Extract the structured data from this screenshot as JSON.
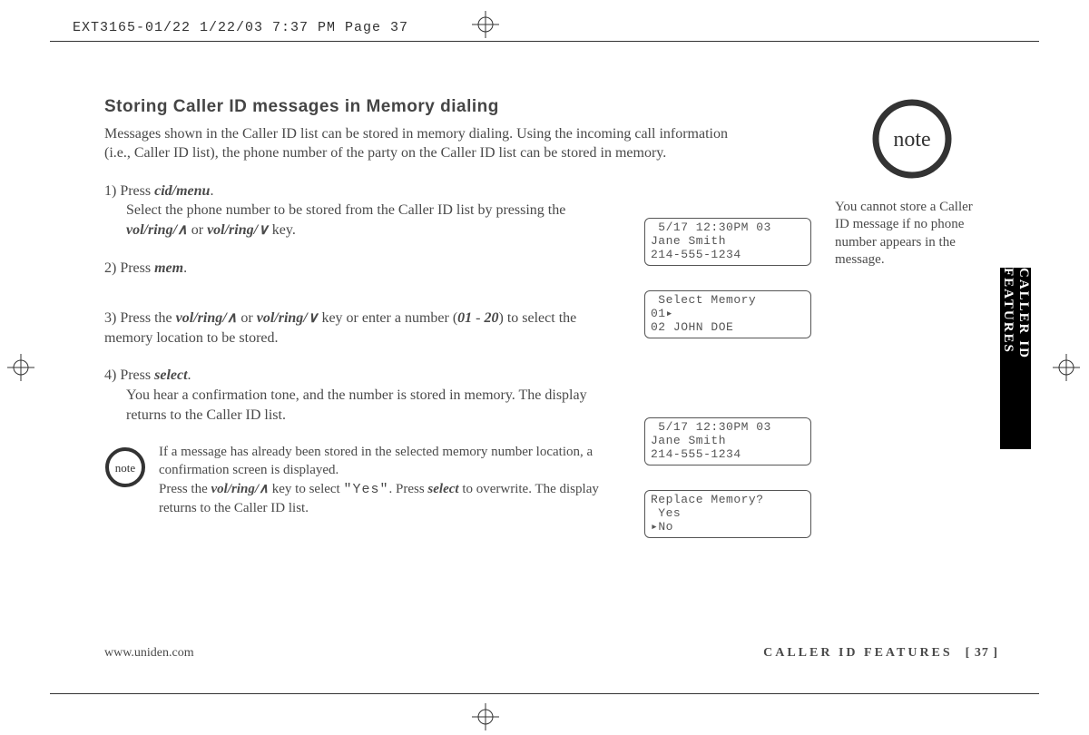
{
  "header_line": "EXT3165-01/22  1/22/03  7:37 PM  Page 37",
  "title": "Storing Caller ID messages in Memory dialing",
  "intro": "Messages shown in the Caller ID list can be stored in memory dialing. Using the incoming call information (i.e., Caller ID list), the phone number of the party on the Caller ID list can be stored in memory.",
  "steps": {
    "s1_num": "1) Press ",
    "s1_cmd": "cid/menu",
    "s1_dot": ".",
    "s1_body_a": "Select the phone number to be stored from the Caller ID list by pressing the ",
    "s1_key1": "vol/ring/",
    "s1_or": " or ",
    "s1_key2": "vol/ring/",
    "s1_end": " key.",
    "s2_num": "2) Press ",
    "s2_cmd": "mem",
    "s2_dot": ".",
    "s3_num": "3) Press the ",
    "s3_key1": "vol/ring/",
    "s3_or": " or ",
    "s3_key2": "vol/ring/",
    "s3_mid": " key or enter a number (",
    "s3_b01": "01",
    "s3_dash": " - ",
    "s3_b20": "20",
    "s3_end": ") to select the memory location to be stored.",
    "s4_num": "4) Press ",
    "s4_cmd": "select",
    "s4_dot": ".",
    "s4_body": "You hear a confirmation tone, and the number is stored in memory. The display returns to the Caller ID list."
  },
  "inline_note": {
    "a": "If a message has already been stored in the selected memory number location, a confirmation screen is displayed.",
    "b_pre": "Press the ",
    "b_key": "vol/ring/",
    "b_mid": " key to select ",
    "b_yes": "\"Yes\"",
    "b_press": ". Press ",
    "b_sel": "select",
    "b_end": " to overwrite. The display returns to the Caller ID list."
  },
  "lcds": {
    "l1": " 5/17 12:30PM 03\nJane Smith\n214-555-1234",
    "l2": " Select Memory\n01▸\n02 JOHN DOE",
    "l3": " 5/17 12:30PM 03\nJane Smith\n214-555-1234",
    "l4": "Replace Memory?\n Yes\n▸No"
  },
  "sidebar_note": "You cannot store a Caller ID message if no phone number appears in the message.",
  "side_tab": "CALLER ID FEATURES",
  "note_icon_label": "note",
  "footer": {
    "url": "www.uniden.com",
    "section": "CALLER ID FEATURES",
    "page": "[ 37 ]"
  },
  "glyphs": {
    "up": "∧",
    "down": "∨"
  }
}
